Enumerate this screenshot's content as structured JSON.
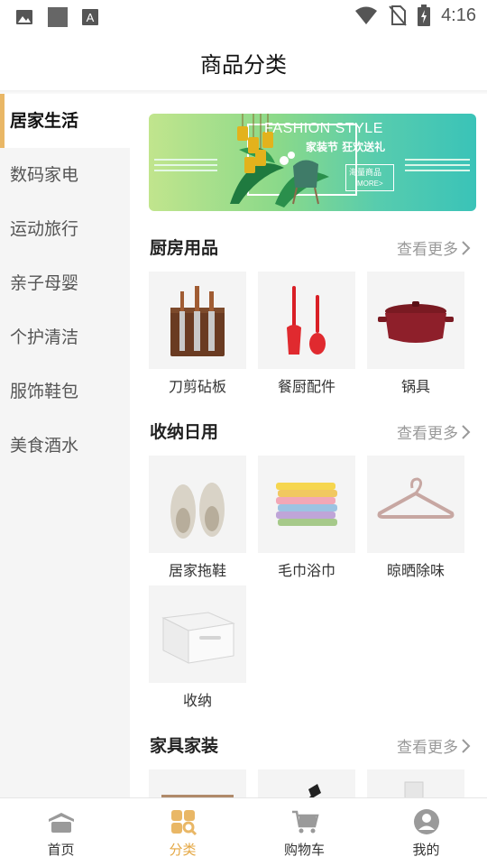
{
  "status_bar": {
    "time": "4:16",
    "left_icons": [
      "image-icon",
      "square-icon",
      "text-a-icon"
    ],
    "right_icons": [
      "wifi-icon",
      "no-sim-icon",
      "battery-charging-icon"
    ]
  },
  "header": {
    "title": "商品分类"
  },
  "sidebar": {
    "active_index": 0,
    "items": [
      {
        "label": "居家生活"
      },
      {
        "label": "数码家电"
      },
      {
        "label": "运动旅行"
      },
      {
        "label": "亲子母婴"
      },
      {
        "label": "个护清洁"
      },
      {
        "label": "服饰鞋包"
      },
      {
        "label": "美食酒水"
      }
    ]
  },
  "banner": {
    "headline": "FASHION STYLE",
    "subline": "家装节 狂欢送礼",
    "cta_line1": "海量商品",
    "cta_line2": "MORE>"
  },
  "sections": [
    {
      "title": "厨房用品",
      "more": "查看更多",
      "items": [
        {
          "label": "刀剪砧板",
          "icon": "knife-block-icon"
        },
        {
          "label": "餐厨配件",
          "icon": "kitchen-utensils-icon"
        },
        {
          "label": "锅具",
          "icon": "pot-icon"
        }
      ]
    },
    {
      "title": "收纳日用",
      "more": "查看更多",
      "items": [
        {
          "label": "居家拖鞋",
          "icon": "slippers-icon"
        },
        {
          "label": "毛巾浴巾",
          "icon": "towels-icon"
        },
        {
          "label": "晾晒除味",
          "icon": "hanger-icon"
        },
        {
          "label": "收纳",
          "icon": "storage-box-icon"
        }
      ]
    },
    {
      "title": "家具家装",
      "more": "查看更多",
      "items": [
        {
          "label": "",
          "icon": "furniture-icon"
        },
        {
          "label": "",
          "icon": "lamp-icon"
        },
        {
          "label": "",
          "icon": "decor-icon"
        }
      ]
    }
  ],
  "bottom_nav": {
    "active_index": 1,
    "items": [
      {
        "label": "首页",
        "icon": "home-icon"
      },
      {
        "label": "分类",
        "icon": "category-icon"
      },
      {
        "label": "购物车",
        "icon": "cart-icon"
      },
      {
        "label": "我的",
        "icon": "profile-icon"
      }
    ]
  },
  "colors": {
    "accent": "#e9b766",
    "nav_active": "#e4a743",
    "sidebar_bg": "#f5f5f5"
  }
}
